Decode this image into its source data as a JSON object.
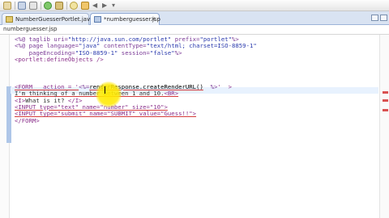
{
  "tabs": [
    {
      "label": "NumberGuesserPortlet.java",
      "active": false
    },
    {
      "label": "*numberguesser.jsp",
      "active": true
    }
  ],
  "breadcrumb": "numberguesser.jsp",
  "code_lines": [
    {
      "parts": [
        {
          "t": "<%@ taglib uri=",
          "c": "c-dir"
        },
        {
          "t": "\"http://java.sun.com/portlet\"",
          "c": "c-str"
        },
        {
          "t": " prefix=",
          "c": "c-dir"
        },
        {
          "t": "\"portlet\"",
          "c": "c-str"
        },
        {
          "t": "%>",
          "c": "c-dir"
        }
      ]
    },
    {
      "parts": [
        {
          "t": "<%@ page language=",
          "c": "c-dir"
        },
        {
          "t": "\"java\"",
          "c": "c-str"
        },
        {
          "t": " contentType=",
          "c": "c-dir"
        },
        {
          "t": "\"text/html; charset=ISO-8859-1\"",
          "c": "c-str"
        }
      ]
    },
    {
      "parts": [
        {
          "t": "    pageEncoding=",
          "c": "c-dir"
        },
        {
          "t": "\"ISO-8859-1\"",
          "c": "c-str"
        },
        {
          "t": " session=",
          "c": "c-dir"
        },
        {
          "t": "\"false\"",
          "c": "c-str"
        },
        {
          "t": "%>",
          "c": "c-dir"
        }
      ]
    },
    {
      "parts": [
        {
          "t": "<portlet:defineObjects />",
          "c": "c-tag"
        }
      ]
    },
    {
      "parts": []
    },
    {
      "parts": []
    },
    {
      "parts": []
    },
    {
      "parts": [
        {
          "t": "<FORM   action = '",
          "c": "c-tag u"
        },
        {
          "t": "<%=",
          "c": "c-dir"
        },
        {
          "t": "renderResponse.createRenderURL()",
          "c": "c-java u"
        },
        {
          "t": "  %>",
          "c": "c-dir"
        },
        {
          "t": "'  >",
          "c": "c-tag"
        }
      ]
    },
    {
      "parts": [
        {
          "t": "I'm thinking of a number between 1 and 10.",
          "c": "c-txt u"
        },
        {
          "t": "<BR>",
          "c": "c-tag u"
        }
      ]
    },
    {
      "parts": [
        {
          "t": "<I>",
          "c": "c-tag"
        },
        {
          "t": "What is it? ",
          "c": "c-txt"
        },
        {
          "t": "</I>",
          "c": "c-tag"
        }
      ]
    },
    {
      "parts": [
        {
          "t": "<INPUT type=\"text\" name=\"number\" size=\"10\">",
          "c": "c-tag u"
        }
      ]
    },
    {
      "parts": [
        {
          "t": "<INPUT type=\"submit\" name=\"SUBMIT\" value=\"Guess!!\">",
          "c": "c-tag u"
        }
      ]
    },
    {
      "parts": [
        {
          "t": "</FORM>",
          "c": "c-tag"
        }
      ]
    }
  ]
}
